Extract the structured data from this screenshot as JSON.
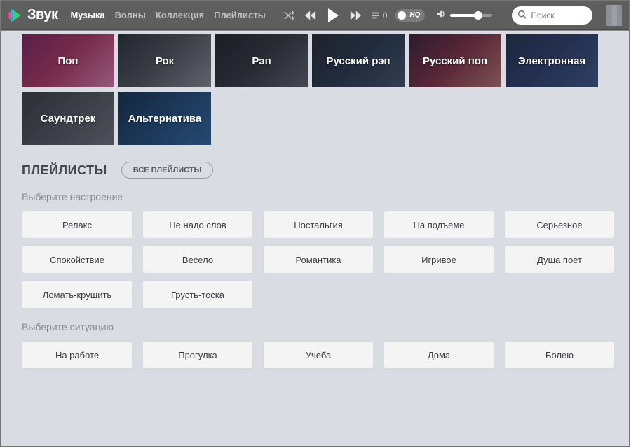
{
  "brand": {
    "name": "Звук"
  },
  "nav": {
    "items": [
      {
        "label": "Музыка",
        "active": true
      },
      {
        "label": "Волны"
      },
      {
        "label": "Коллекция"
      },
      {
        "label": "Плейлисты"
      }
    ]
  },
  "player": {
    "queue_count": "0",
    "hq_label": "HQ"
  },
  "search": {
    "placeholder": "Поиск"
  },
  "genres": [
    {
      "label": "Поп"
    },
    {
      "label": "Рок"
    },
    {
      "label": "Рэп"
    },
    {
      "label": "Русский рэп"
    },
    {
      "label": "Русский поп"
    },
    {
      "label": "Электронная"
    },
    {
      "label": "Саундтрек"
    },
    {
      "label": "Альтернатива"
    }
  ],
  "playlists": {
    "title": "ПЛЕЙЛИСТЫ",
    "all_button": "ВСЕ ПЛЕЙЛИСТЫ",
    "mood": {
      "label": "Выберите настроение",
      "chips": [
        "Релакс",
        "Не надо слов",
        "Ностальгия",
        "На подъеме",
        "Серьезное",
        "Спокойствие",
        "Весело",
        "Романтика",
        "Игривое",
        "Душа поет",
        "Ломать-крушить",
        "Грусть-тоска"
      ]
    },
    "situation": {
      "label": "Выберите ситуацию",
      "chips": [
        "На работе",
        "Прогулка",
        "Учеба",
        "Дома",
        "Болею"
      ]
    }
  }
}
